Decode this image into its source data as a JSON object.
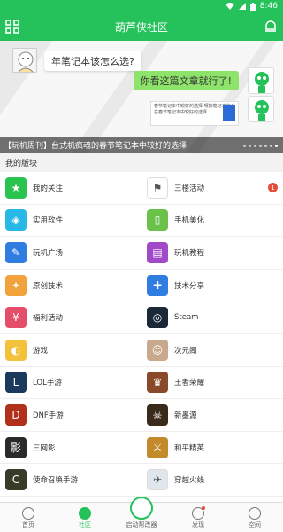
{
  "status": {
    "time": "8:46"
  },
  "header": {
    "title": "葫芦侠社区"
  },
  "banner": {
    "bubble_left": "年笔记本该怎么选?",
    "bubble_right": "你看这篇文章就行了!",
    "mini_card_text": "春节笔记本中较好的选择 哪款笔记本你会在春节笔记本中较好的选择",
    "caption": "【玩机周刊】台式机疯魂的春节笔记本中较好的选择",
    "dots_total": 7,
    "dots_active": 7
  },
  "section": {
    "title": "我的版块"
  },
  "boards": [
    {
      "label": "我的关注",
      "icon": "star-icon",
      "color": "#2bc34f",
      "glyph": "★"
    },
    {
      "label": "三楼活动",
      "icon": "flag-icon",
      "color": "#ffffff",
      "glyph": "⚑",
      "badge": "1"
    },
    {
      "label": "实用软件",
      "icon": "cube-icon",
      "color": "#27b8e5",
      "glyph": "◈"
    },
    {
      "label": "手机美化",
      "icon": "phone-icon",
      "color": "#6bc24a",
      "glyph": "▯"
    },
    {
      "label": "玩机广场",
      "icon": "pencil-icon",
      "color": "#2f7de1",
      "glyph": "✎"
    },
    {
      "label": "玩机教程",
      "icon": "book-icon",
      "color": "#a04ac9",
      "glyph": "▤"
    },
    {
      "label": "原创技术",
      "icon": "lightbulb-icon",
      "color": "#f2a23a",
      "glyph": "✦"
    },
    {
      "label": "技术分享",
      "icon": "wrench-icon",
      "color": "#2f7de1",
      "glyph": "✚"
    },
    {
      "label": "福利活动",
      "icon": "money-bag-icon",
      "color": "#e64d6b",
      "glyph": "¥"
    },
    {
      "label": "Steam",
      "icon": "steam-icon",
      "color": "#1b2838",
      "glyph": "◎"
    },
    {
      "label": "游戏",
      "icon": "gamepad-icon",
      "color": "#f2c23a",
      "glyph": "◐"
    },
    {
      "label": "次元阁",
      "icon": "anime-avatar-icon",
      "color": "#c9a98b",
      "glyph": "☺"
    },
    {
      "label": "LOL手游",
      "icon": "lol-icon",
      "color": "#1a3a5c",
      "glyph": "L"
    },
    {
      "label": "王者荣耀",
      "icon": "honor-of-kings-icon",
      "color": "#8a4a2a",
      "glyph": "♛"
    },
    {
      "label": "DNF手游",
      "icon": "dnf-icon",
      "color": "#b0301c",
      "glyph": "D"
    },
    {
      "label": "新墨源",
      "icon": "one-piece-icon",
      "color": "#3a2a1a",
      "glyph": "☠"
    },
    {
      "label": "三网影",
      "icon": "movie-icon",
      "color": "#2a2a2a",
      "glyph": "影"
    },
    {
      "label": "和平精英",
      "icon": "pubg-icon",
      "color": "#c28a2a",
      "glyph": "⚔"
    },
    {
      "label": "使命召唤手游",
      "icon": "cod-icon",
      "color": "#3a3a2a",
      "glyph": "C"
    },
    {
      "label": "穿越火线",
      "icon": "crossfire-icon",
      "color": "#dfe6ee",
      "glyph": "✈"
    }
  ],
  "tabs": [
    {
      "label": "首页",
      "icon": "home-icon"
    },
    {
      "label": "社区",
      "icon": "community-icon",
      "active": true
    },
    {
      "label": "启动帮改器",
      "icon": "launcher-icon",
      "center": true
    },
    {
      "label": "发现",
      "icon": "discover-icon",
      "badge": true
    },
    {
      "label": "空间",
      "icon": "profile-icon"
    }
  ],
  "colors": {
    "brand": "#25c15b",
    "badge": "#e74c3c"
  }
}
